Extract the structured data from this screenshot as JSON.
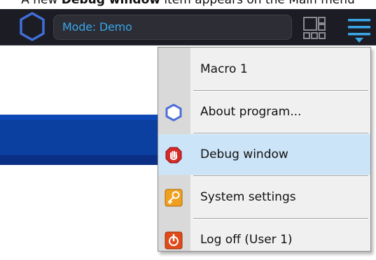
{
  "caption": {
    "prefix": "A new ",
    "bold": "Debug window",
    "suffix": " item appears on the Main menu"
  },
  "header": {
    "mode_text": "Mode: Demo",
    "logo_icon": "hexagon-logo-icon",
    "layout_icon": "layout-grid-icon",
    "menu_icon": "hamburger-menu-icon"
  },
  "menu": {
    "items": [
      {
        "label": "Macro 1",
        "icon": ""
      },
      {
        "label": "About program...",
        "icon": "hexagon-info-icon"
      },
      {
        "label": "Debug window",
        "icon": "stop-hand-icon"
      },
      {
        "label": "System settings",
        "icon": "key-settings-icon"
      },
      {
        "label": "Log off (User 1)",
        "icon": "power-logoff-icon"
      }
    ],
    "highlighted_index": 2
  },
  "colors": {
    "header_bg": "#1c1c24",
    "accent_blue": "#3aa6e8",
    "highlight": "#cce4f7",
    "background_bar": "#0b3fa0"
  }
}
